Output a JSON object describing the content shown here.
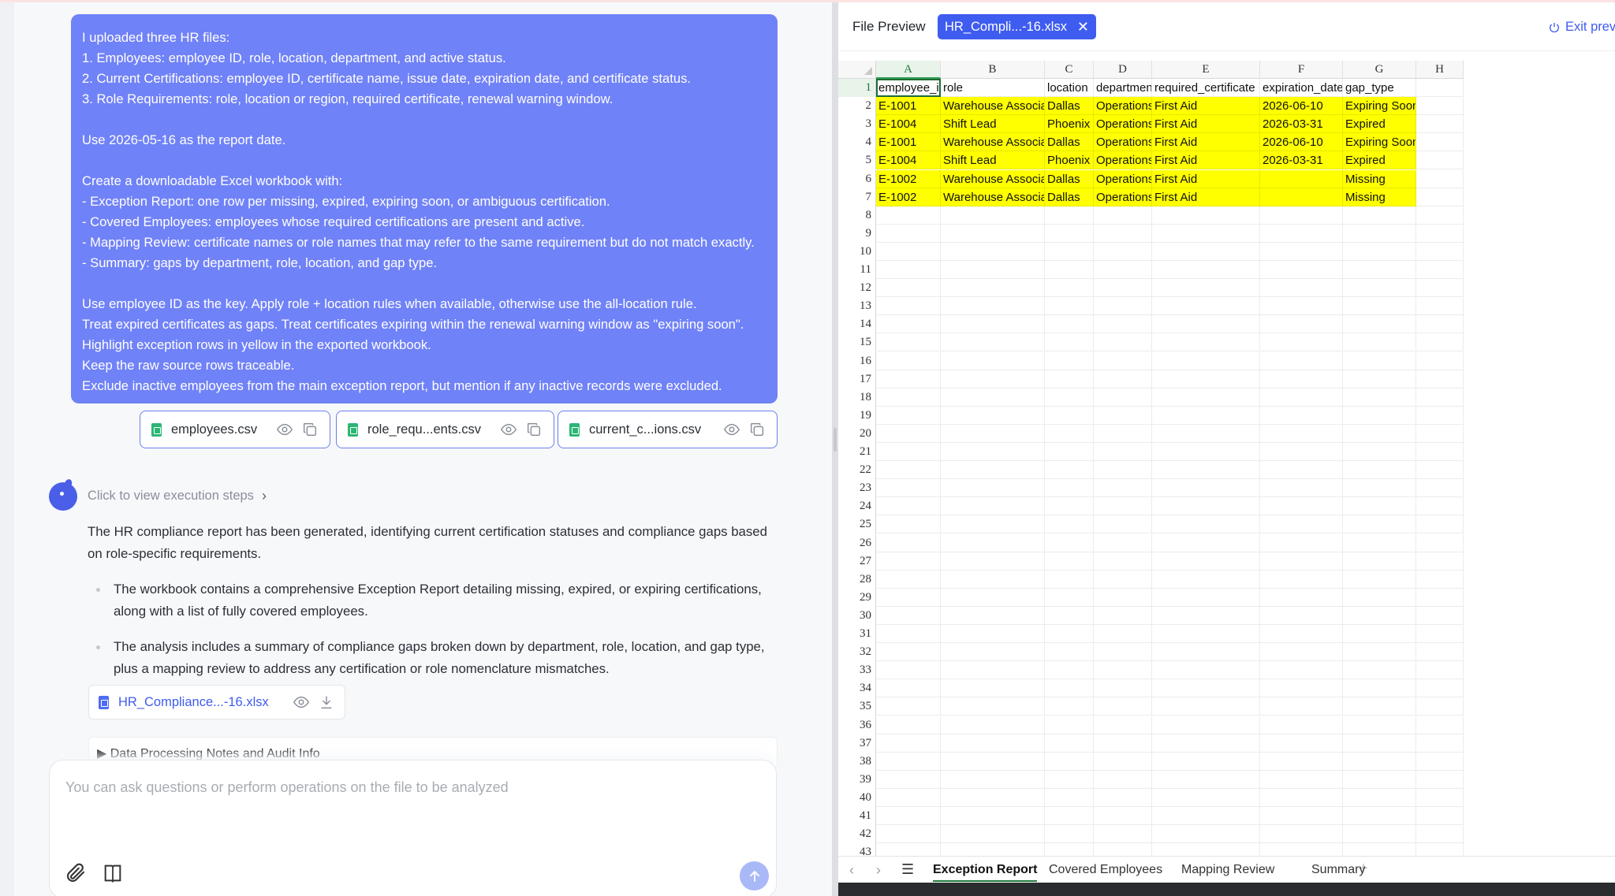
{
  "chat": {
    "user_message_lines": [
      "I uploaded three HR files:",
      "1. Employees: employee ID, role, location, department, and active status.",
      "2. Current Certifications: employee ID, certificate name, issue date, expiration date, and certificate status.",
      "3. Role Requirements: role, location or region, required certificate, renewal warning window.",
      "",
      "Use 2026-05-16 as the report date.",
      "",
      "Create a downloadable Excel workbook with:",
      "- Exception Report: one row per missing, expired, expiring soon, or ambiguous certification.",
      "- Covered Employees: employees whose required certifications are present and active.",
      "- Mapping Review: certificate names or role names that may refer to the same requirement but do not match exactly.",
      "- Summary: gaps by department, role, location, and gap type.",
      "",
      "Use employee ID as the key. Apply role + location rules when available, otherwise use the all-location rule.",
      "Treat expired certificates as gaps. Treat certificates expiring within the renewal warning window as \"expiring soon\".",
      "Highlight exception rows in yellow in the exported workbook.",
      "Keep the raw source rows traceable.",
      "Exclude inactive employees from the main exception report, but mention if any inactive records were excluded."
    ],
    "attachments": [
      {
        "name": "employees.csv"
      },
      {
        "name": "role_requ...ents.csv"
      },
      {
        "name": "current_c...ions.csv"
      }
    ],
    "execution_steps_label": "Click to view execution steps",
    "reply_intro": "The HR compliance report has been generated, identifying current certification statuses and compliance gaps based on role-specific requirements.",
    "reply_bullets": [
      "The workbook contains a comprehensive Exception Report detailing missing, expired, or expiring certifications, along with a list of fully covered employees.",
      "The analysis includes a summary of compliance gaps broken down by department, role, location, and gap type, plus a mapping review to address any certification or role nomenclature mismatches."
    ],
    "download_file": "HR_Compliance...-16.xlsx",
    "notes_label": "▶ Data Processing Notes and Audit Info",
    "composer_placeholder": "You can ask questions or perform operations on the file to be analyzed"
  },
  "preview": {
    "title": "File Preview",
    "tab_label": "HR_Compli...-16.xlsx",
    "exit_label": "Exit prev",
    "columns": [
      "A",
      "B",
      "C",
      "D",
      "E",
      "F",
      "G",
      "H"
    ],
    "header_row": [
      "employee_id",
      "role",
      "location",
      "department",
      "required_certificate",
      "expiration_date",
      "gap_type"
    ],
    "rows": [
      [
        "E-1001",
        "Warehouse Associate",
        "Dallas",
        "Operations",
        "First Aid",
        "2026-06-10",
        "Expiring Soon"
      ],
      [
        "E-1004",
        "Shift Lead",
        "Phoenix",
        "Operations",
        "First Aid",
        "2026-03-31",
        "Expired"
      ],
      [
        "E-1001",
        "Warehouse Associate",
        "Dallas",
        "Operations",
        "First Aid",
        "2026-06-10",
        "Expiring Soon"
      ],
      [
        "E-1004",
        "Shift Lead",
        "Phoenix",
        "Operations",
        "First Aid",
        "2026-03-31",
        "Expired"
      ],
      [
        "E-1002",
        "Warehouse Associate",
        "Dallas",
        "Operations",
        "First Aid",
        "",
        "Missing"
      ],
      [
        "E-1002",
        "Warehouse Associate",
        "Dallas",
        "Operations",
        "First Aid",
        "",
        "Missing"
      ]
    ],
    "row_numbers": [
      "1",
      "2",
      "3",
      "4",
      "5",
      "6",
      "7",
      "8",
      "9",
      "10",
      "11",
      "12",
      "13",
      "14",
      "15",
      "16",
      "17",
      "18",
      "19",
      "20",
      "21",
      "22",
      "23",
      "24",
      "25",
      "26",
      "27",
      "28",
      "29",
      "30",
      "31",
      "32",
      "33",
      "34",
      "35",
      "36",
      "37",
      "38",
      "39",
      "40",
      "41",
      "42",
      "43"
    ],
    "highlight_color": "#ffff00",
    "sheets": [
      "Exception Report",
      "Covered Employees",
      "Mapping Review",
      "Summary"
    ],
    "active_sheet": "Exception Report"
  },
  "colors": {
    "user_bubble": "#7082f7",
    "accent": "#3f5cf0",
    "sheet_accent": "#1f7a3d"
  }
}
